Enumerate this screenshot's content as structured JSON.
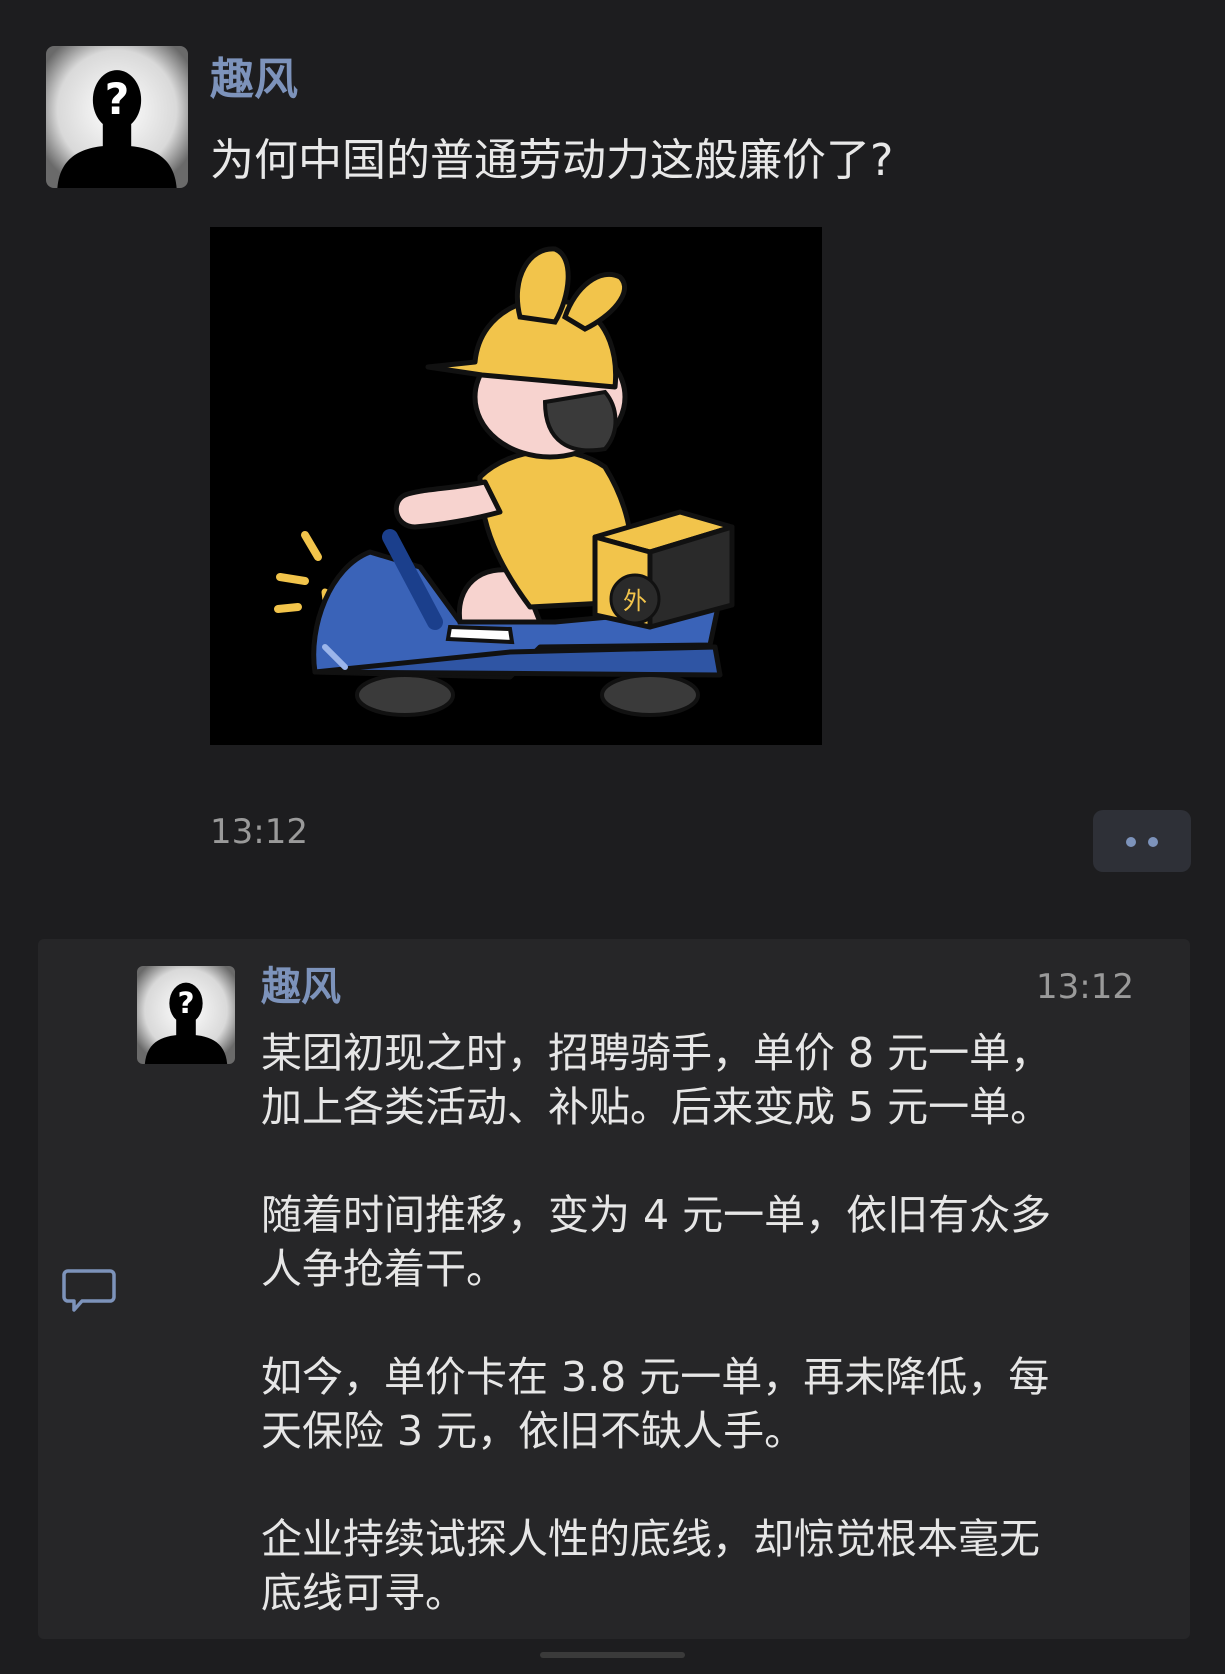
{
  "post": {
    "author": "趣风",
    "title": "为何中国的普通劳动力这般廉价了?",
    "image_icon": "delivery-rider-scooter-illustration",
    "image_box_label": "外",
    "time": "13:12"
  },
  "comment": {
    "author": "趣风",
    "time": "13:12",
    "paragraphs": [
      "某团初现之时，招聘骑手，单价 8 元一单，\n加上各类活动、补贴。后来变成 5 元一单。",
      "随着时间推移，变为 4 元一单，依旧有众多\n人争抢着干。",
      "如今，单价卡在 3.8 元一单，再未降低，每\n天保险 3 元，依旧不缺人手。",
      "企业持续试探人性的底线，却惊觉根本毫无\n底线可寻。"
    ]
  },
  "icons": {
    "avatar": "anonymous-person-question-mark-icon",
    "more": "ellipsis-icon",
    "comment": "comment-bubble-icon"
  },
  "colors": {
    "background": "#1d1d1f",
    "panel": "#262628",
    "accent_name": "#7d93bb",
    "text": "#e6e6e6",
    "muted": "#9a9a9a",
    "helmet_yellow": "#f2c44b",
    "scooter_blue": "#3a63b8"
  }
}
